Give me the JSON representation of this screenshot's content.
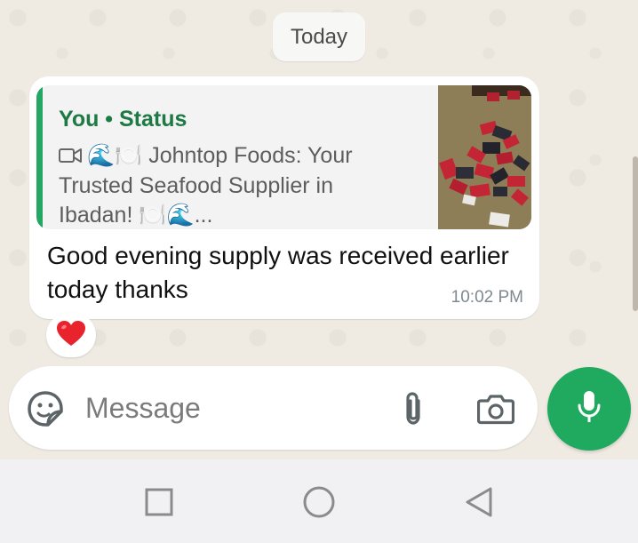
{
  "date_separator": "Today",
  "message": {
    "quote_author": "You • Status",
    "quote_text": "🌊🍽️ Johntop Foods: Your Trusted Seafood Supplier in Ibadan! 🍽️🌊...",
    "text": "Good evening supply was received earlier today thanks",
    "time": "10:02 PM",
    "reaction": "❤️"
  },
  "composer": {
    "placeholder": "Message"
  },
  "icons": {
    "quote_media": "video-icon",
    "sticker": "sticker-icon",
    "attach": "paperclip-icon",
    "camera": "camera-icon",
    "mic": "mic-icon",
    "nav_recent": "square-icon",
    "nav_home": "circle-icon",
    "nav_back": "triangle-back-icon"
  },
  "colors": {
    "accent_green": "#1faa5f",
    "quote_bar": "#25a764",
    "quote_author": "#1d7a45",
    "chat_background": "#efeae2"
  }
}
